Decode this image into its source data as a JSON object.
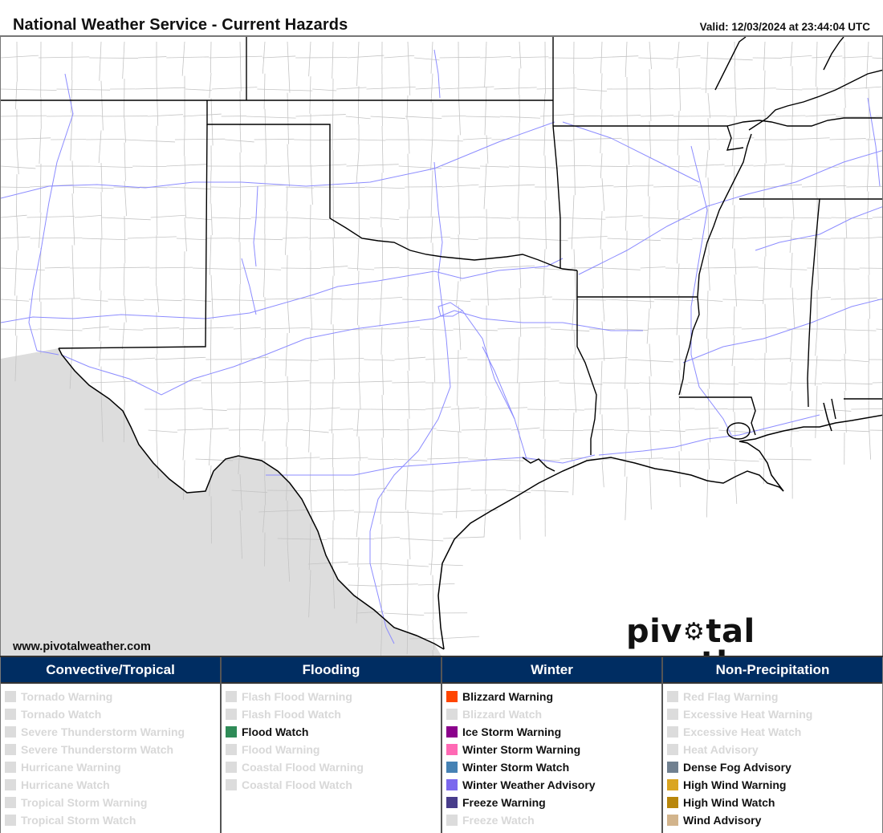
{
  "header": {
    "title": "National Weather Service - Current Hazards",
    "valid": "Valid: 12/03/2024 at 23:44:04 UTC"
  },
  "map": {
    "region": "South Central United States",
    "states_visible": [
      "New Mexico",
      "Colorado",
      "Kansas",
      "Missouri",
      "Oklahoma",
      "Texas",
      "Arkansas",
      "Louisiana",
      "Mississippi",
      "Tennessee",
      "Alabama",
      "Kentucky",
      "Illinois"
    ],
    "colors": {
      "land": "#ffffff",
      "outside_us": "#dddddd",
      "water": "#ffffff",
      "state_border": "#000000",
      "county_border": "#bbbbbb",
      "interstate": "#8c8cff"
    },
    "active_hazard_areas": []
  },
  "footer": {
    "site_url": "www.pivotalweather.com",
    "brand_left": "piv",
    "brand_right": "tal weather",
    "brand_icon": "gear-icon"
  },
  "legend": {
    "columns": [
      {
        "title": "Convective/Tropical",
        "items": [
          {
            "label": "Tornado Warning",
            "active": false,
            "color": "#dcdcdc"
          },
          {
            "label": "Tornado Watch",
            "active": false,
            "color": "#dcdcdc"
          },
          {
            "label": "Severe Thunderstorm Warning",
            "active": false,
            "color": "#dcdcdc"
          },
          {
            "label": "Severe Thunderstorm Watch",
            "active": false,
            "color": "#dcdcdc"
          },
          {
            "label": "Hurricane Warning",
            "active": false,
            "color": "#dcdcdc"
          },
          {
            "label": "Hurricane Watch",
            "active": false,
            "color": "#dcdcdc"
          },
          {
            "label": "Tropical Storm Warning",
            "active": false,
            "color": "#dcdcdc"
          },
          {
            "label": "Tropical Storm Watch",
            "active": false,
            "color": "#dcdcdc"
          }
        ]
      },
      {
        "title": "Flooding",
        "items": [
          {
            "label": "Flash Flood Warning",
            "active": false,
            "color": "#dcdcdc"
          },
          {
            "label": "Flash Flood Watch",
            "active": false,
            "color": "#dcdcdc"
          },
          {
            "label": "Flood Watch",
            "active": true,
            "color": "#2e8b57"
          },
          {
            "label": "Flood Warning",
            "active": false,
            "color": "#dcdcdc"
          },
          {
            "label": "Coastal Flood Warning",
            "active": false,
            "color": "#dcdcdc"
          },
          {
            "label": "Coastal Flood Watch",
            "active": false,
            "color": "#dcdcdc"
          }
        ]
      },
      {
        "title": "Winter",
        "items": [
          {
            "label": "Blizzard Warning",
            "active": true,
            "color": "#ff4500"
          },
          {
            "label": "Blizzard Watch",
            "active": false,
            "color": "#dcdcdc"
          },
          {
            "label": "Ice Storm Warning",
            "active": true,
            "color": "#8b008b"
          },
          {
            "label": "Winter Storm Warning",
            "active": true,
            "color": "#ff69b4"
          },
          {
            "label": "Winter Storm Watch",
            "active": true,
            "color": "#4682b4"
          },
          {
            "label": "Winter Weather Advisory",
            "active": true,
            "color": "#7b68ee"
          },
          {
            "label": "Freeze Warning",
            "active": true,
            "color": "#483d8b"
          },
          {
            "label": "Freeze Watch",
            "active": false,
            "color": "#dcdcdc"
          }
        ]
      },
      {
        "title": "Non-Precipitation",
        "items": [
          {
            "label": "Red Flag Warning",
            "active": false,
            "color": "#dcdcdc"
          },
          {
            "label": "Excessive Heat Warning",
            "active": false,
            "color": "#dcdcdc"
          },
          {
            "label": "Excessive Heat Watch",
            "active": false,
            "color": "#dcdcdc"
          },
          {
            "label": "Heat Advisory",
            "active": false,
            "color": "#dcdcdc"
          },
          {
            "label": "Dense Fog Advisory",
            "active": true,
            "color": "#708090"
          },
          {
            "label": "High Wind Warning",
            "active": true,
            "color": "#daa520"
          },
          {
            "label": "High Wind Watch",
            "active": true,
            "color": "#b8860b"
          },
          {
            "label": "Wind Advisory",
            "active": true,
            "color": "#d2b48c"
          }
        ]
      }
    ]
  }
}
